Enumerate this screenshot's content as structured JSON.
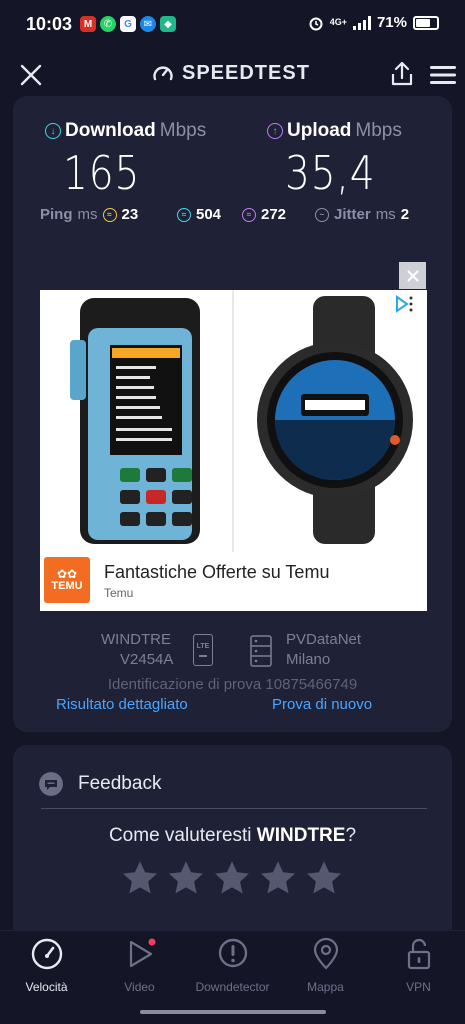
{
  "status_bar": {
    "time": "10:03",
    "network": "4G+",
    "battery": "71%",
    "battery_level": 0.71
  },
  "header": {
    "brand": "SPEEDTEST"
  },
  "result": {
    "download_label": "Download",
    "download_unit": "Mbps",
    "download_value": "165",
    "upload_label": "Upload",
    "upload_unit": "Mbps",
    "upload_value": "35,4",
    "ping_label": "Ping",
    "ping_unit": "ms",
    "ping_idle": "23",
    "ping_download": "504",
    "ping_upload": "272",
    "jitter_label": "Jitter",
    "jitter_unit": "ms",
    "jitter_value": "2"
  },
  "ad": {
    "title": "Fantastiche Offerte su Temu",
    "advertiser": "Temu",
    "logo_text": "TEMU",
    "device_screen_title": "Setting option",
    "device_screen_lines": [
      "Per-price:  100",
      "Slope:",
      "Area unit:",
      "Lenth unit:",
      "LCD light:   60 %",
      "Time UTC:   01:00",
      "Press\"▲▼\" to choose",
      "Press\"OK\" to adjust"
    ],
    "watch_month": "February",
    "watch_time": "08:30",
    "watch_seconds": "55",
    "watch_steps": "23456",
    "watch_kcal": "2345",
    "watch_sleep": "08h45",
    "watch_hr": "089"
  },
  "provider": {
    "carrier": "WINDTRE",
    "device": "V2454A",
    "connection_badge": "LTE",
    "server": "PVDataNet",
    "city": "Milano",
    "test_id": "Identificazione di prova 10875466749",
    "detail_link": "Risultato dettagliato",
    "retry_link": "Prova di nuovo"
  },
  "feedback": {
    "title": "Feedback",
    "question_prefix": "Come valuteresti ",
    "question_carrier": "WINDTRE",
    "question_suffix": "?"
  },
  "bottom_nav": {
    "items": [
      {
        "label": "Velocità"
      },
      {
        "label": "Video"
      },
      {
        "label": "Downdetector"
      },
      {
        "label": "Mappa"
      },
      {
        "label": "VPN"
      }
    ]
  },
  "colors": {
    "background": "#141526",
    "card": "#1f2136",
    "download_accent": "#45d8e0",
    "upload_accent": "#c27bf2",
    "ping_accent": "#f2c744",
    "link": "#4aa4ff"
  }
}
